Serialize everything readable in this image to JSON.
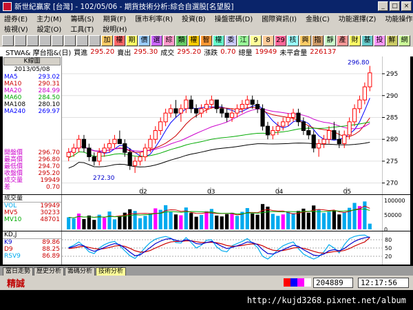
{
  "window": {
    "title": "新世紀贏家 [台灣] - 102/05/06 - 期貨技術分析:綜合自選股[名望股]",
    "min": "_",
    "max": "□",
    "close": "×"
  },
  "menu": {
    "row1": [
      "證券(E)",
      "主力(M)",
      "籌碼(S)",
      "期貨(F)",
      "匯市利率(R)",
      "投資(B)",
      "操盤密碼(D)",
      "國際資訊(I)",
      "金融(C)",
      "功能選擇(Z)",
      "功能操作(O)"
    ],
    "row2": [
      "檢視(V)",
      "設定(O)",
      "工具(T)",
      "說明(H)"
    ]
  },
  "toolbar": [
    "加",
    "權",
    "期",
    "價",
    "選",
    "綜",
    "類",
    "權",
    "智",
    "權",
    "委",
    "江",
    "9",
    "8",
    "29",
    "核",
    "興",
    "指",
    "靜",
    "產",
    "財",
    "基",
    "投",
    "鮮",
    "網"
  ],
  "info": {
    "symbol": "STWA& 摩台指&(日)",
    "bid_label": "買進",
    "bid": "295.20",
    "ask_label": "賣出",
    "ask": "295.30",
    "last_label": "成交",
    "last": "295.20",
    "change_label": "漲跌",
    "change": "0.70",
    "volume_label": "總量",
    "volume": "19949",
    "oi_label": "未平倉量",
    "oi": "226137"
  },
  "left": {
    "kline_button": "K線圖",
    "date": "2013/05/08",
    "ma": [
      {
        "label": "MA5",
        "value": "293.02",
        "color": "#0000ff"
      },
      {
        "label": "MA10",
        "value": "290.31",
        "color": "#cc0000"
      },
      {
        "label": "MA20",
        "value": "284.99",
        "color": "#cc00cc"
      },
      {
        "label": "MA60",
        "value": "284.50",
        "color": "#00aa00"
      },
      {
        "label": "MA108",
        "value": "280.10",
        "color": "#000000"
      },
      {
        "label": "MA240",
        "value": "269.97",
        "color": "#0000ff"
      }
    ],
    "quote": [
      {
        "label": "開盤價",
        "value": "296.70"
      },
      {
        "label": "最高價",
        "value": "296.80"
      },
      {
        "label": "最低價",
        "value": "294.70"
      },
      {
        "label": "收盤價",
        "value": "295.20"
      },
      {
        "label": "成交量",
        "value": "19949"
      },
      {
        "label": "差",
        "value": "0.70"
      }
    ]
  },
  "chart_data": {
    "type": "candlestick",
    "price_axis": [
      "295",
      "290",
      "285",
      "280",
      "275",
      "270"
    ],
    "price_range": [
      269,
      298
    ],
    "date_ticks": [
      "02",
      "03",
      "04",
      "05"
    ],
    "annotations": {
      "high": "296.80",
      "low": "272.30"
    },
    "candles": [
      [
        276,
        278,
        275,
        277
      ],
      [
        277,
        279,
        276,
        278
      ],
      [
        278,
        281,
        277,
        280
      ],
      [
        280,
        281,
        277,
        278
      ],
      [
        278,
        279,
        275,
        276
      ],
      [
        276,
        277,
        274,
        275
      ],
      [
        275,
        278,
        274,
        277
      ],
      [
        277,
        279,
        276,
        278
      ],
      [
        278,
        280,
        277,
        279
      ],
      [
        279,
        281,
        278,
        280
      ],
      [
        280,
        282,
        279,
        279
      ],
      [
        279,
        280,
        276,
        277
      ],
      [
        277,
        278,
        273,
        274
      ],
      [
        274,
        276,
        272.3,
        275
      ],
      [
        275,
        277,
        274,
        276
      ],
      [
        276,
        279,
        275,
        278
      ],
      [
        278,
        281,
        277,
        280
      ],
      [
        280,
        283,
        279,
        282
      ],
      [
        282,
        285,
        281,
        284
      ],
      [
        284,
        287,
        283,
        286
      ],
      [
        286,
        288,
        285,
        287
      ],
      [
        287,
        289,
        285,
        286
      ],
      [
        286,
        288,
        284,
        287
      ],
      [
        287,
        290,
        286,
        289
      ],
      [
        289,
        290,
        286,
        287
      ],
      [
        287,
        288,
        285,
        286
      ],
      [
        286,
        288,
        285,
        287
      ],
      [
        287,
        289,
        286,
        288
      ],
      [
        288,
        290,
        287,
        289
      ],
      [
        289,
        289,
        286,
        287
      ],
      [
        287,
        288,
        285,
        286
      ],
      [
        286,
        287,
        284,
        285
      ],
      [
        285,
        287,
        284,
        286
      ],
      [
        286,
        288,
        285,
        287
      ],
      [
        287,
        289,
        286,
        288
      ],
      [
        288,
        290,
        287,
        289
      ],
      [
        289,
        290,
        287,
        288
      ],
      [
        288,
        289,
        286,
        287
      ],
      [
        287,
        288,
        282,
        283
      ],
      [
        283,
        284,
        280,
        281
      ],
      [
        281,
        283,
        280,
        282
      ],
      [
        282,
        284,
        281,
        283
      ],
      [
        283,
        285,
        282,
        284
      ],
      [
        284,
        286,
        283,
        285
      ],
      [
        285,
        287,
        284,
        286
      ],
      [
        286,
        287,
        283,
        284
      ],
      [
        284,
        285,
        281,
        282
      ],
      [
        282,
        283,
        280,
        281
      ],
      [
        281,
        282,
        277,
        278
      ],
      [
        278,
        280,
        276,
        279
      ],
      [
        279,
        281,
        278,
        280
      ],
      [
        280,
        283,
        279,
        282
      ],
      [
        282,
        284,
        281,
        280
      ],
      [
        280,
        282,
        278,
        279
      ],
      [
        279,
        282,
        278,
        281
      ],
      [
        281,
        285,
        280,
        284
      ],
      [
        284,
        288,
        283,
        287
      ],
      [
        287,
        290,
        286,
        289
      ],
      [
        289,
        293,
        288,
        292
      ],
      [
        292,
        296.8,
        291,
        295.2
      ]
    ],
    "vol_axis": [
      "100000",
      "50000",
      "0"
    ],
    "volume_range": [
      0,
      110000
    ],
    "volumes": [
      42000,
      38000,
      55000,
      36000,
      48000,
      33000,
      51000,
      40000,
      62000,
      35000,
      46000,
      58000,
      70000,
      64000,
      39000,
      47000,
      55000,
      73000,
      68000,
      84000,
      60000,
      52000,
      49000,
      76000,
      57000,
      44000,
      50000,
      63000,
      71000,
      48000,
      45000,
      53000,
      58000,
      47000,
      61000,
      74000,
      55000,
      51000,
      88000,
      79000,
      54000,
      47000,
      52000,
      60000,
      56000,
      64000,
      72000,
      58000,
      83000,
      69000,
      57000,
      61000,
      66000,
      52000,
      59000,
      75000,
      92000,
      81000,
      97000,
      19949
    ],
    "kdj_axis": [
      "80",
      "50",
      "20"
    ],
    "kdj_range": [
      0,
      100
    ],
    "k": [
      50,
      55,
      62,
      58,
      45,
      38,
      44,
      52,
      60,
      66,
      62,
      50,
      35,
      22,
      25,
      38,
      52,
      66,
      75,
      82,
      84,
      78,
      74,
      80,
      76,
      66,
      64,
      70,
      74,
      66,
      56,
      48,
      52,
      58,
      64,
      72,
      70,
      62,
      44,
      30,
      28,
      35,
      44,
      52,
      60,
      56,
      44,
      34,
      24,
      22,
      28,
      40,
      44,
      40,
      48,
      62,
      74,
      82,
      87,
      89.86
    ],
    "d": [
      48,
      50,
      54,
      56,
      52,
      48,
      46,
      48,
      52,
      57,
      59,
      56,
      49,
      40,
      35,
      36,
      41,
      50,
      58,
      66,
      72,
      74,
      74,
      76,
      76,
      73,
      70,
      70,
      71,
      69,
      65,
      59,
      56,
      57,
      59,
      63,
      65,
      64,
      58,
      49,
      42,
      40,
      41,
      45,
      50,
      52,
      49,
      44,
      38,
      33,
      31,
      34,
      37,
      38,
      41,
      48,
      57,
      65,
      72,
      88.25
    ],
    "rsv": [
      52,
      60,
      72,
      56,
      36,
      30,
      50,
      62,
      70,
      74,
      58,
      40,
      22,
      12,
      30,
      52,
      70,
      82,
      88,
      92,
      86,
      70,
      68,
      88,
      70,
      50,
      60,
      78,
      80,
      54,
      40,
      36,
      58,
      66,
      74,
      84,
      68,
      52,
      20,
      10,
      24,
      44,
      58,
      66,
      72,
      48,
      28,
      18,
      10,
      18,
      36,
      62,
      50,
      32,
      62,
      84,
      92,
      96,
      97,
      86.89
    ]
  },
  "volume_panel": {
    "title": "成交量",
    "rows": [
      {
        "label": "VOL",
        "value": "19949",
        "color": "#00aaee"
      },
      {
        "label": "MV5",
        "value": "30233",
        "color": "#cc0000"
      },
      {
        "label": "MV10",
        "value": "48701",
        "color": "#00aa00"
      }
    ]
  },
  "kdj_panel": {
    "title": "KD,J",
    "rows": [
      {
        "label": "K9",
        "value": "89.86",
        "color": "#0000cc"
      },
      {
        "label": "D9",
        "value": "88.25",
        "color": "#cc0000"
      },
      {
        "label": "RSV9",
        "value": "86.89",
        "color": "#00aaee"
      }
    ]
  },
  "tabs": [
    "當日走勢",
    "歷史分析",
    "籌碼分析",
    "技術分析"
  ],
  "status": {
    "label": "精誠",
    "count": "204889",
    "time": "12:17:56"
  },
  "watermark": "http://kujd3268.pixnet.net/album",
  "colors": {
    "up": "#ff0000",
    "down": "#000000",
    "bg": "#ffffff",
    "accent": "#0a246a"
  }
}
